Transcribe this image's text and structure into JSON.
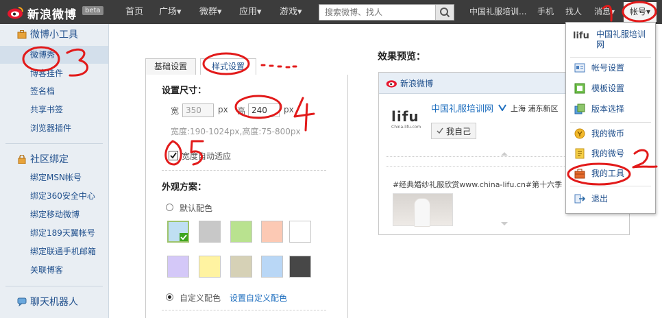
{
  "header": {
    "logo_text": "新浪微博",
    "beta": "beta",
    "nav": [
      "首页",
      "广场▾",
      "微群▾",
      "应用▾",
      "游戏▾"
    ],
    "search_placeholder": "搜索微博、找人",
    "top_links": [
      "中国礼服培训...",
      "手机",
      "找人",
      "消息▾"
    ],
    "account": "帐号▾"
  },
  "sidebar": {
    "tools_title": "微博小工具",
    "tools_items": [
      "微博秀",
      "博客挂件",
      "签名档",
      "共享书签",
      "浏览器插件"
    ],
    "bind_title": "社区绑定",
    "bind_items": [
      "绑定MSN帐号",
      "绑定360安全中心",
      "绑定移动微博",
      "绑定189天翼帐号",
      "绑定联通手机邮箱",
      "关联博客"
    ],
    "robot_title": "聊天机器人"
  },
  "main": {
    "tabs": [
      "基础设置",
      "样式设置"
    ],
    "size_title": "设置尺寸：",
    "width_label": "宽",
    "width_value": "350",
    "px1": "px",
    "height_label": "高",
    "height_value": "240",
    "px2": "px",
    "size_hint": "宽度:190-1024px,高度:75-800px",
    "auto_label": "宽度自动适应",
    "look_title": "外观方案：",
    "default_color": "默认配色",
    "custom_color": "自定义配色",
    "custom_link": "设置自定义配色",
    "swatches": [
      "#bfdff2",
      "#c8c8c8",
      "#b9e28f",
      "#fcc9b4",
      "#ffffff",
      "#d4c8f8",
      "#fff3a1",
      "#d6d1b6",
      "#b9d7f6",
      "#474747"
    ]
  },
  "preview": {
    "title": "效果预览：",
    "brand": "新浪微博",
    "lifu": "lifu",
    "lifu_sub": "China-lifu.com",
    "user": "中国礼服培训网",
    "location": "上海 浦东新区",
    "self_btn": "我自己",
    "post": "#经典婚纱礼服欣赏www.china-lifu.cn#第十六季"
  },
  "dropdown": {
    "site_name": "中国礼服培训网",
    "logo": "lifu",
    "items": [
      "帐号设置",
      "模板设置",
      "版本选择",
      "我的微币",
      "我的微号",
      "我的工具",
      "退出"
    ]
  },
  "colors": {
    "topbar": "#3c3c3c",
    "sidebar_bg": "#e9eef3",
    "link": "#1f4f8c",
    "annotation": "#e21a1a"
  }
}
